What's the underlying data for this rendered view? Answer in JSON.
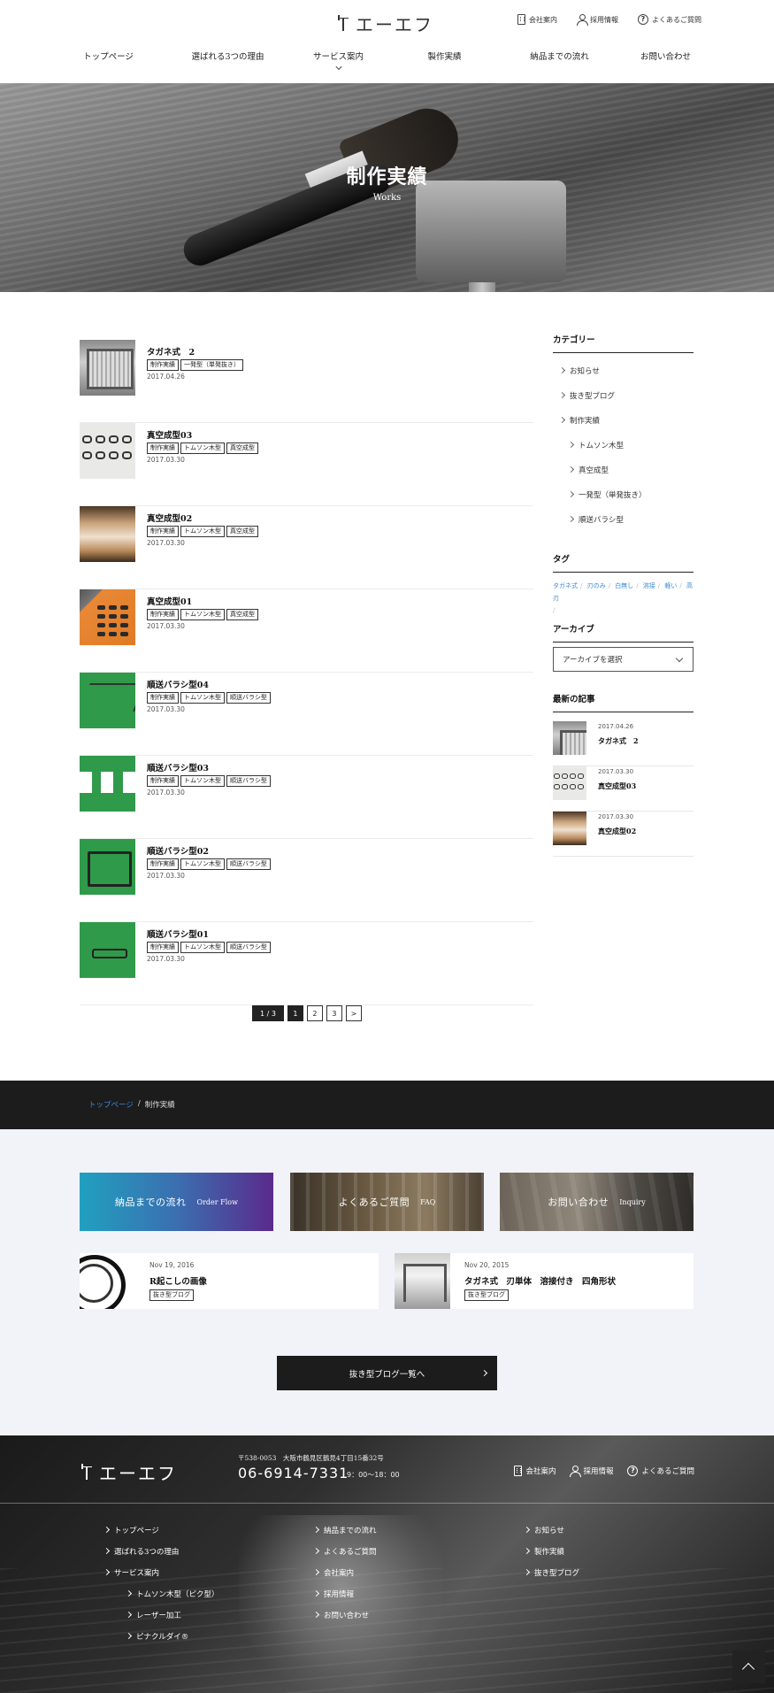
{
  "header": {
    "logo_text": "エーエフ",
    "util_nav": [
      "会社案内",
      "採用情報",
      "よくあるご質問"
    ],
    "main_nav": [
      "トップページ",
      "選ばれる3つの理由",
      "サービス案内",
      "製作実績",
      "納品までの流れ",
      "お問い合わせ"
    ]
  },
  "hero": {
    "title": "制作実績",
    "subtitle": "Works"
  },
  "posts": [
    {
      "title": "タガネ式　2",
      "tags": [
        "制作実績",
        "一発型（単発抜き）"
      ],
      "date": "2017.04.26"
    },
    {
      "title": "真空成型03",
      "tags": [
        "制作実績",
        "トムソン木型",
        "真空成型"
      ],
      "date": "2017.03.30"
    },
    {
      "title": "真空成型02",
      "tags": [
        "制作実績",
        "トムソン木型",
        "真空成型"
      ],
      "date": "2017.03.30"
    },
    {
      "title": "真空成型01",
      "tags": [
        "制作実績",
        "トムソン木型",
        "真空成型"
      ],
      "date": "2017.03.30"
    },
    {
      "title": "順送バラシ型04",
      "tags": [
        "制作実績",
        "トムソン木型",
        "順送バラシ型"
      ],
      "date": "2017.03.30"
    },
    {
      "title": "順送バラシ型03",
      "tags": [
        "制作実績",
        "トムソン木型",
        "順送バラシ型"
      ],
      "date": "2017.03.30"
    },
    {
      "title": "順送バラシ型02",
      "tags": [
        "制作実績",
        "トムソン木型",
        "順送バラシ型"
      ],
      "date": "2017.03.30"
    },
    {
      "title": "順送バラシ型01",
      "tags": [
        "制作実績",
        "トムソン木型",
        "順送バラシ型"
      ],
      "date": "2017.03.30"
    }
  ],
  "pagination": {
    "count": "1 / 3",
    "pages": [
      "1",
      "2",
      "3"
    ],
    "next": ">"
  },
  "sidebar": {
    "category_title": "カテゴリー",
    "categories": [
      "お知らせ",
      "抜き型ブログ",
      "制作実績",
      "トムソン木型",
      "真空成型",
      "一発型（単発抜き）",
      "順送バラシ型"
    ],
    "tag_title": "タグ",
    "tags": [
      "タガネ式",
      "刃のみ",
      "白無し",
      "溶接",
      "軽い",
      "高刃"
    ],
    "archive_title": "アーカイブ",
    "archive_placeholder": "アーカイブを選択",
    "recent_title": "最新の記事",
    "recent": [
      {
        "date": "2017.04.26",
        "title": "タガネ式　2"
      },
      {
        "date": "2017.03.30",
        "title": "真空成型03"
      },
      {
        "date": "2017.03.30",
        "title": "真空成型02"
      }
    ]
  },
  "breadcrumb": {
    "home": "トップページ",
    "separator": "/",
    "current": "制作実績"
  },
  "banners": [
    {
      "main": "納品までの流れ",
      "sub": "Order Flow"
    },
    {
      "main": "よくあるご質問",
      "sub": "FAQ"
    },
    {
      "main": "お問い合わせ",
      "sub": "Inquiry"
    }
  ],
  "blog_cards": [
    {
      "date": "Nov 19, 2016",
      "title": "R起こしの画像",
      "tag": "抜き型ブログ"
    },
    {
      "date": "Nov 20, 2015",
      "title": "タガネ式　刃単体　溶接付き　四角形状",
      "tag": "抜き型ブログ"
    }
  ],
  "blog_button": "抜き型ブログ一覧へ",
  "footer": {
    "logo_text": "エーエフ",
    "address": "〒538-0053　大阪市鶴見区鶴見4丁目15番32号",
    "tel": "06-6914-7331",
    "hours": "9：00～18：00",
    "util_nav": [
      "会社案内",
      "採用情報",
      "よくあるご質問"
    ],
    "col1": [
      "トップページ",
      "選ばれる3つの理由",
      "サービス案内"
    ],
    "col1_sub": [
      "トムソン木型（ピク型）",
      "レーザー加工",
      "ピナクルダイ®"
    ],
    "col2": [
      "納品までの流れ",
      "よくあるご質問",
      "会社案内",
      "採用情報",
      "お問い合わせ"
    ],
    "col3": [
      "お知らせ",
      "製作実績",
      "抜き型ブログ"
    ]
  }
}
